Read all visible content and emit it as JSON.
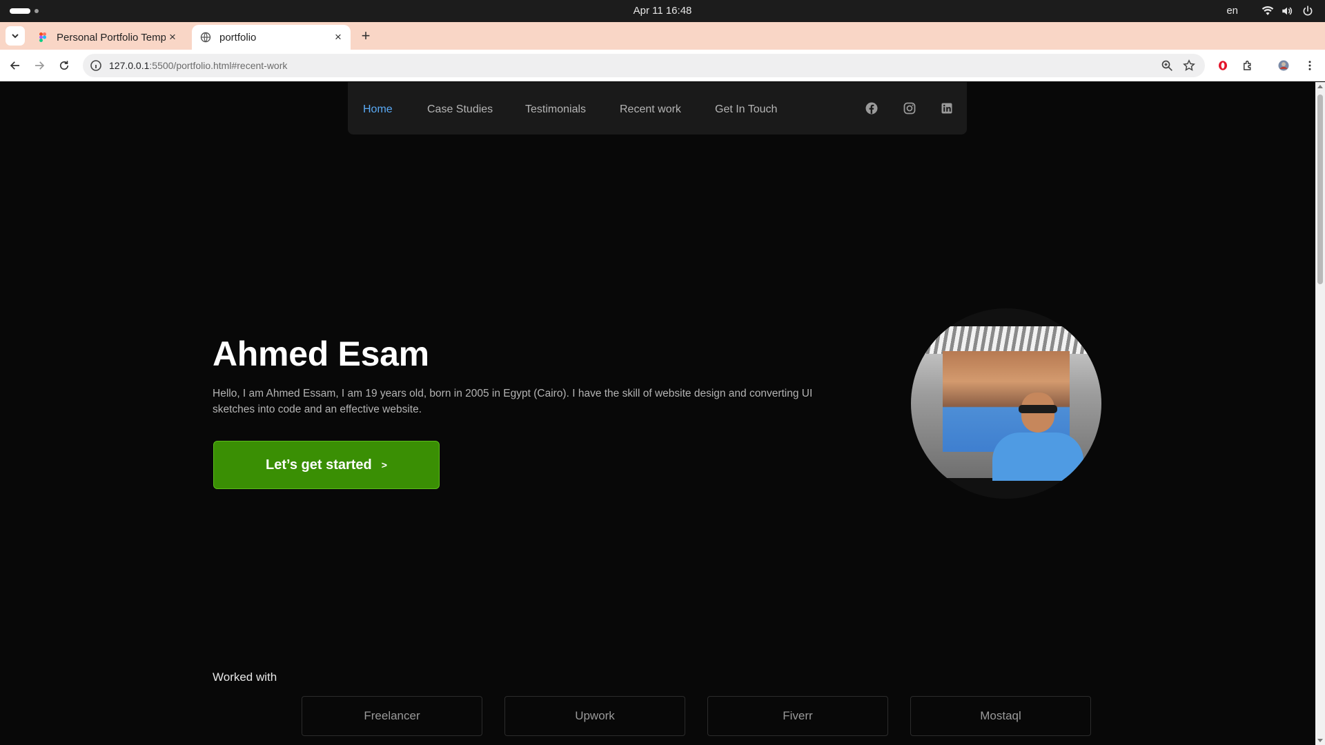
{
  "os": {
    "clock": "Apr 11  16:48",
    "language": "en",
    "icons": [
      "wifi-icon",
      "volume-icon",
      "power-icon"
    ]
  },
  "browser": {
    "tabs": [
      {
        "title": "Personal Portfolio Templ",
        "favicon": "figma-icon",
        "active": false
      },
      {
        "title": "portfolio",
        "favicon": "globe-icon",
        "active": true
      }
    ],
    "url": {
      "host": "127.0.0.1",
      "rest": ":5500/portfolio.html#recent-work"
    },
    "accent": "#f9d6c6"
  },
  "nav": {
    "links": [
      "Home",
      "Case Studies",
      "Testimonials",
      "Recent work",
      "Get In Touch"
    ],
    "active_link": "Home",
    "socials": [
      "facebook-icon",
      "instagram-icon",
      "linkedin-icon"
    ]
  },
  "hero": {
    "name": "Ahmed Esam",
    "bio": "Hello, I am Ahmed Essam, I am 19 years old, born in 2005 in Egypt (Cairo). I have the skill of website design and converting UI sketches into code and an effective website.",
    "cta_label": "Let’s get started",
    "cta_arrow": ">",
    "cta_color": "#3a8f04"
  },
  "worked_with": {
    "title": "Worked with",
    "partners": [
      "Freelancer",
      "Upwork",
      "Fiverr",
      "Mostaql"
    ]
  }
}
